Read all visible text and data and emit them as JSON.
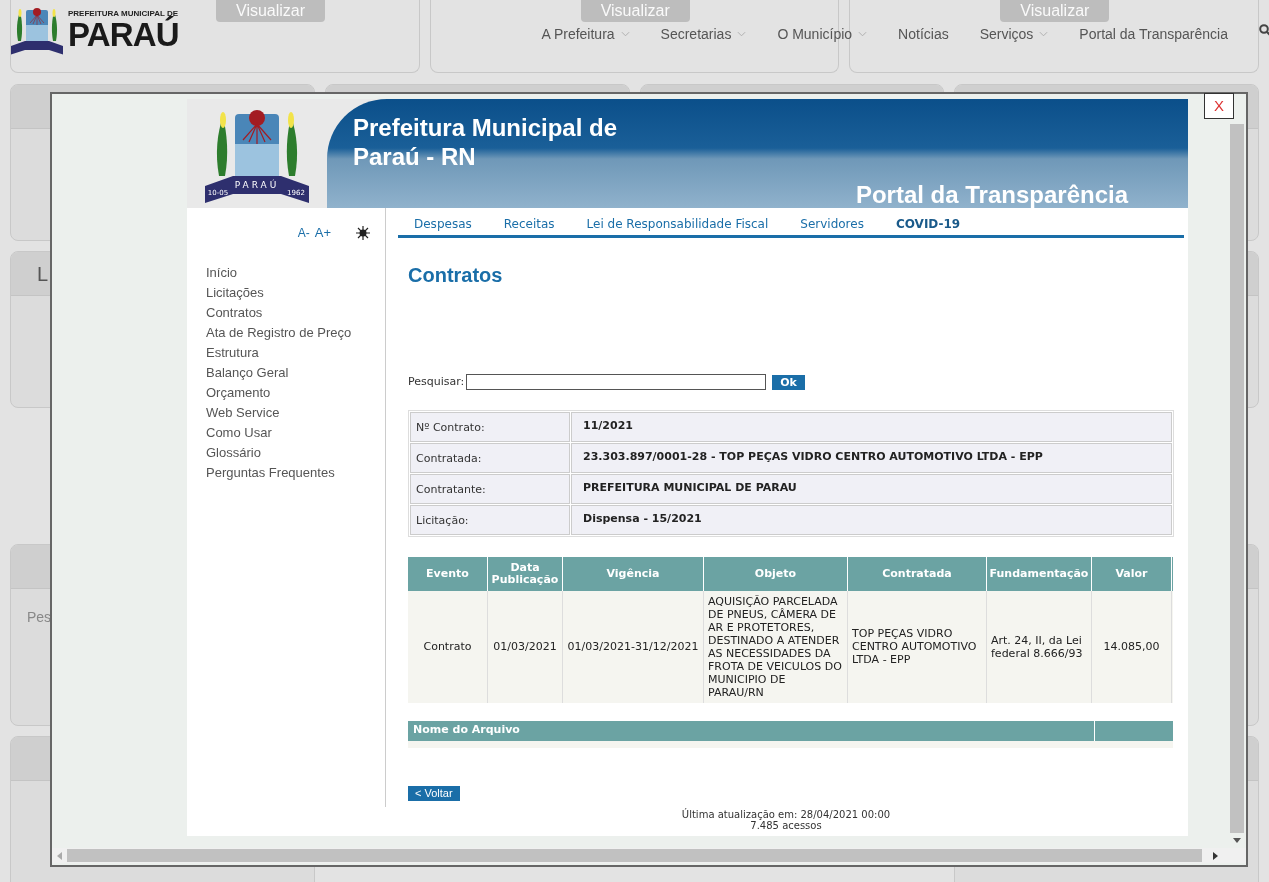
{
  "background_page": {
    "logo_small": "PREFEITURA MUNICIPAL DE",
    "logo_large": "PARAÚ",
    "nav": [
      {
        "label": "A Prefeitura",
        "dropdown": true
      },
      {
        "label": "Secretarias",
        "dropdown": true
      },
      {
        "label": "O Município",
        "dropdown": true
      },
      {
        "label": "Notícias",
        "dropdown": false
      },
      {
        "label": "Serviços",
        "dropdown": true
      },
      {
        "label": "Portal da Transparência",
        "dropdown": false
      }
    ],
    "card_buttons": [
      "Visualizar",
      "Visualizar",
      "Visualizar"
    ],
    "card_fragments": [
      "L",
      "Pes"
    ]
  },
  "modal": {
    "close_label": "X",
    "banner": {
      "title_line1": "Prefeitura Municipal de",
      "title_line2": "Paraú - RN",
      "subtitle": "Portal da Transparência",
      "seal_name": "PARAÚ",
      "seal_dates": [
        "10-05",
        "1962"
      ]
    },
    "font_controls": [
      "A-",
      "A+"
    ],
    "sidebar": [
      "Início",
      "Licitações",
      "Contratos",
      "Ata de Registro de Preço",
      "Estrutura",
      "Balanço Geral",
      "Orçamento",
      "Web Service",
      "Como Usar",
      "Glossário",
      "Perguntas Frequentes"
    ],
    "tabs": [
      {
        "label": "Despesas",
        "emphasis": false
      },
      {
        "label": "Receitas",
        "emphasis": false
      },
      {
        "label": "Lei de Responsabilidade Fiscal",
        "emphasis": false
      },
      {
        "label": "Servidores",
        "emphasis": false
      },
      {
        "label": "COVID-19",
        "emphasis": true
      }
    ],
    "page_title": "Contratos",
    "search": {
      "label": "Pesquisar:",
      "button": "Ok"
    },
    "details": [
      {
        "label": "Nº Contrato:",
        "value": "11/2021"
      },
      {
        "label": "Contratada:",
        "value": "23.303.897/0001-28 - TOP PEÇAS VIDRO CENTRO AUTOMOTIVO LTDA - EPP"
      },
      {
        "label": "Contratante:",
        "value": "PREFEITURA MUNICIPAL DE PARAU"
      },
      {
        "label": "Licitação:",
        "value": "Dispensa - 15/2021"
      }
    ],
    "events_table": {
      "columns": [
        "Evento",
        "Data Publicação",
        "Vigência",
        "Objeto",
        "Contratada",
        "Fundamentação",
        "Valor"
      ],
      "rows": [
        [
          "Contrato",
          "01/03/2021",
          "01/03/2021-31/12/2021",
          "AQUISIÇÃO PARCELADA DE PNEUS, CÂMERA DE AR E PROTETORES, DESTINADO A ATENDER AS NECESSIDADES DA FROTA DE VEICULOS DO MUNICIPIO DE PARAU/RN",
          "TOP PEÇAS VIDRO CENTRO AUTOMOTIVO LTDA - EPP",
          "Art. 24, II, da Lei federal 8.666/93",
          "14.085,00"
        ]
      ]
    },
    "files_table": {
      "columns": [
        "Nome do Arquivo"
      ]
    },
    "back_button": "< Voltar",
    "footer": [
      "Última atualização em: 28/04/2021 00:00",
      "7.485 acessos"
    ]
  }
}
